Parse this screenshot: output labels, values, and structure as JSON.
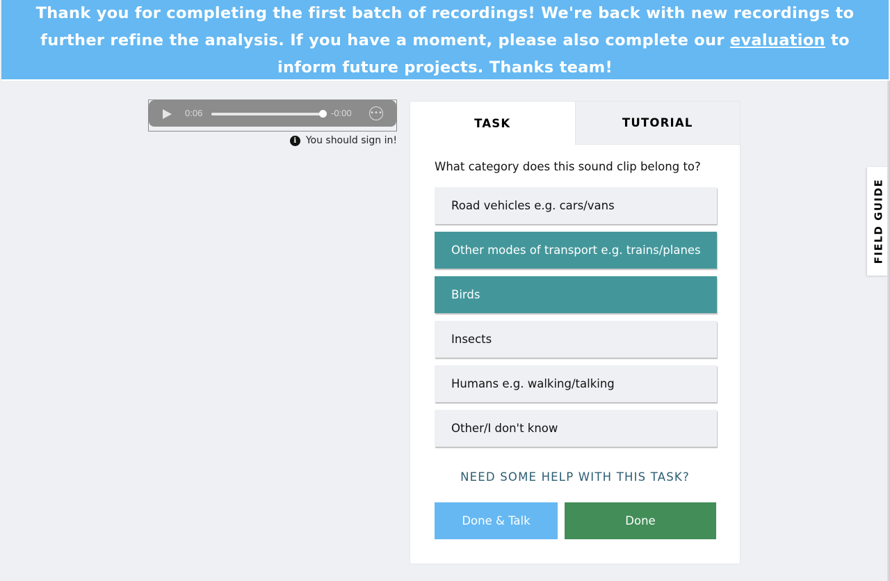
{
  "banner": {
    "text_before": "Thank you for completing the first batch of recordings! We're back with new recordings to further refine the analysis. If you have a moment, please also complete our ",
    "link_text": "evaluation",
    "text_after": " to inform future projects. Thanks team!"
  },
  "player": {
    "current_time": "0:06",
    "remaining_time": "-0:00",
    "progress": 1.0,
    "play_icon": "play-icon",
    "more_icon": "more-options-icon"
  },
  "signin": {
    "icon": "info-icon",
    "text": "You should sign in!"
  },
  "tabs": {
    "task": "TASK",
    "tutorial": "TUTORIAL"
  },
  "task": {
    "question": "What category does this sound clip belong to?",
    "answers": [
      {
        "label": "Road vehicles e.g. cars/vans",
        "selected": false
      },
      {
        "label": "Other modes of transport e.g. trains/planes",
        "selected": true
      },
      {
        "label": "Birds",
        "selected": true
      },
      {
        "label": "Insects",
        "selected": false
      },
      {
        "label": "Humans e.g. walking/talking",
        "selected": false
      },
      {
        "label": "Other/I don't know",
        "selected": false
      }
    ],
    "help": "NEED SOME HELP WITH THIS TASK?",
    "done_talk": "Done & Talk",
    "done": "Done"
  },
  "field_guide": "FIELD GUIDE",
  "colors": {
    "banner": "#65b8f2",
    "selected_answer": "#43979b",
    "done": "#428d58",
    "done_talk": "#65b8f2",
    "help_link": "#2b5e73"
  }
}
